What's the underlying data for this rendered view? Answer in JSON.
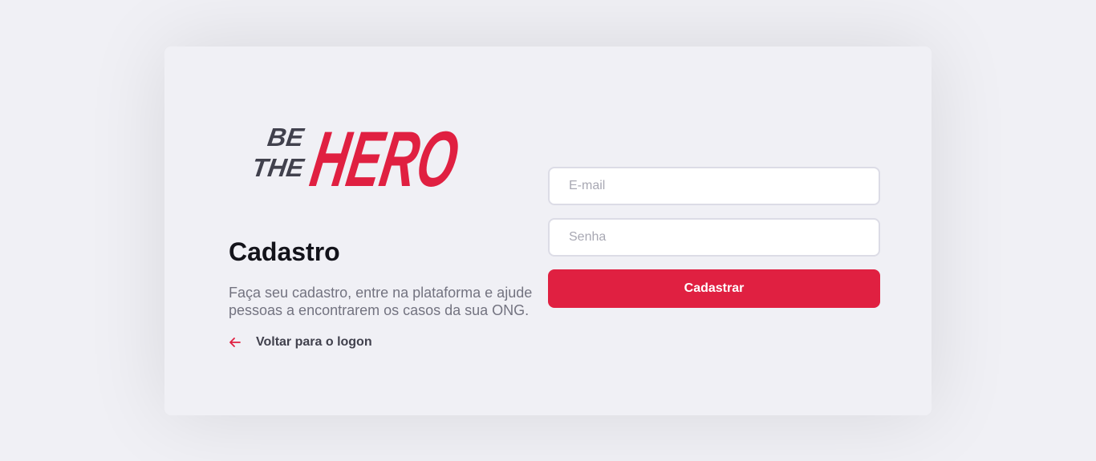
{
  "logo": {
    "text_small_1": "BE",
    "text_small_2": "THE",
    "text_big": "HERO",
    "colors": {
      "small": "#41414d",
      "big": "#e02041"
    }
  },
  "section": {
    "title": "Cadastro",
    "description": "Faça seu cadastro, entre na plataforma e ajude pessoas a encontrarem os casos da sua ONG.",
    "back_link_label": "Voltar para o logon",
    "back_icon": "arrow-left-icon"
  },
  "form": {
    "email_placeholder": "E-mail",
    "email_value": "",
    "password_placeholder": "Senha",
    "password_value": "",
    "submit_label": "Cadastrar"
  },
  "colors": {
    "background": "#f0f0f5",
    "accent": "#e02041",
    "text_dark": "#13131a",
    "text_muted": "#737380",
    "input_border": "#dcdce6"
  }
}
